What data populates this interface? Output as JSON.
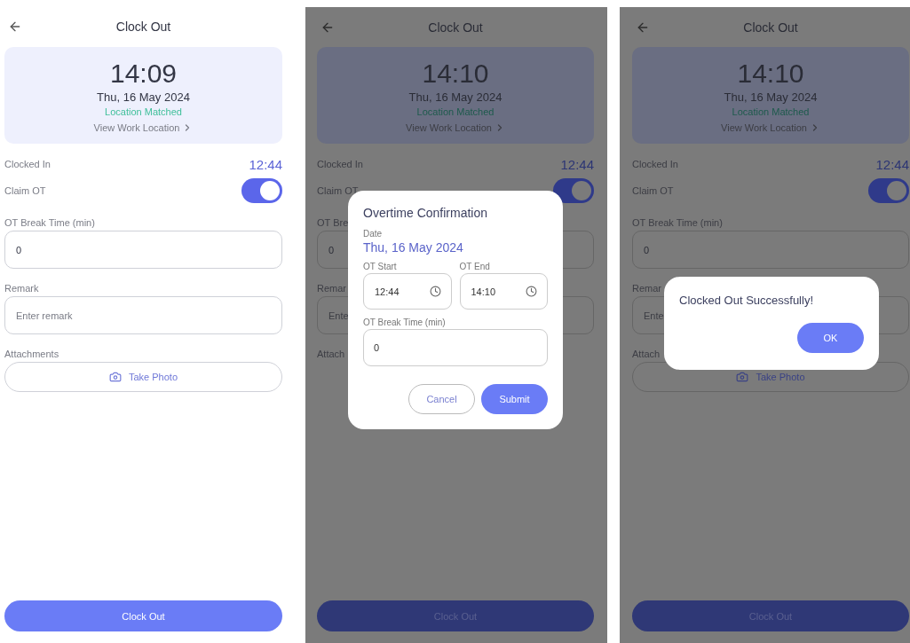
{
  "screens": [
    {
      "dimmed": false,
      "header": {
        "title": "Clock Out"
      },
      "clock_card": {
        "time": "14:09",
        "date": "Thu, 16 May 2024",
        "location_status": "Location Matched",
        "link": "View Work Location"
      },
      "clocked_in": {
        "label": "Clocked In",
        "value": "12:44"
      },
      "claim_ot": {
        "label": "Claim OT",
        "on": true
      },
      "fields": [
        {
          "label": "OT Break Time (min)",
          "value": "0"
        },
        {
          "label": "Remark",
          "placeholder": "Enter remark"
        }
      ],
      "attachments": {
        "label": "Attachments",
        "button": "Take Photo"
      },
      "primary_button": "Clock Out"
    },
    {
      "dimmed": true,
      "header": {
        "title": "Clock Out"
      },
      "clock_card": {
        "time": "14:10",
        "date": "Thu, 16 May 2024",
        "location_status": "Location Matched",
        "link": "View Work Location"
      },
      "clocked_in": {
        "label": "Clocked In",
        "value": "12:44"
      },
      "claim_ot": {
        "label": "Claim OT",
        "on": true
      },
      "fields": [
        {
          "label": "OT Bre",
          "value": "0"
        },
        {
          "label": "Remar",
          "placeholder": "Ente"
        }
      ],
      "attachments": {
        "label": "Attach"
      },
      "primary_button": "Clock Out",
      "dialog": {
        "kind": "overtime",
        "title": "Overtime Confirmation",
        "date_label": "Date",
        "date": "Thu, 16 May 2024",
        "start": {
          "label": "OT Start",
          "value": "12:44"
        },
        "end": {
          "label": "OT End",
          "value": "14:10"
        },
        "break": {
          "label": "OT Break Time (min)",
          "value": "0"
        },
        "buttons": [
          {
            "label": "Cancel",
            "kind": "secondary"
          },
          {
            "label": "Submit",
            "kind": "primary"
          }
        ]
      }
    },
    {
      "dimmed": true,
      "header": {
        "title": "Clock Out"
      },
      "clock_card": {
        "time": "14:10",
        "date": "Thu, 16 May 2024",
        "location_status": "Location Matched",
        "link": "View Work Location"
      },
      "clocked_in": {
        "label": "Clocked In",
        "value": "12:44"
      },
      "claim_ot": {
        "label": "Claim OT",
        "on": true
      },
      "fields": [
        {
          "label": "OT Break Time (min)",
          "value": "0"
        },
        {
          "label": "Remar",
          "placeholder": "Ente"
        }
      ],
      "attachments": {
        "label": "Attach",
        "button": "Take Photo"
      },
      "primary_button": "Clock Out",
      "dialog": {
        "kind": "message",
        "message": "Clocked Out Successfully!",
        "buttons": [
          {
            "label": "OK",
            "kind": "primary"
          }
        ]
      }
    }
  ]
}
